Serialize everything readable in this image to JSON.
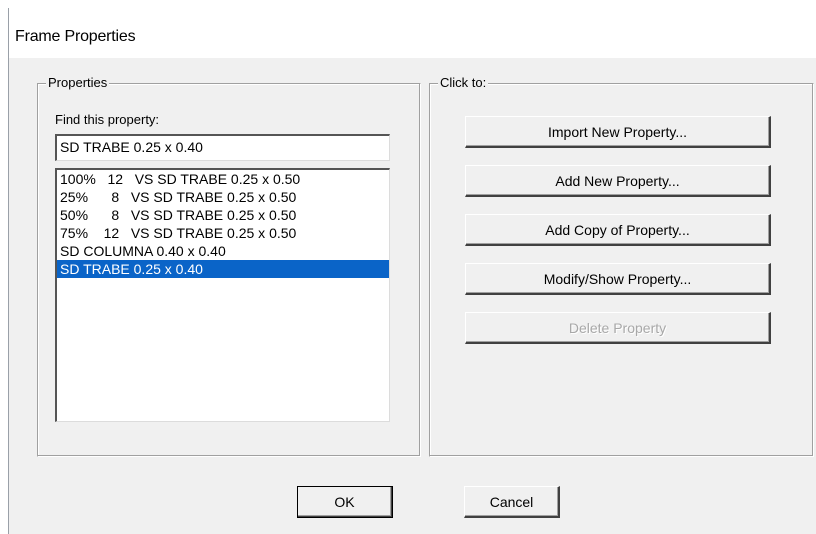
{
  "window": {
    "title": "Frame Properties"
  },
  "properties_group": {
    "label": "Properties",
    "find_label": "Find this property:",
    "find_value": "SD TRABE 0.25 x 0.40",
    "items": [
      "100%   12   VS SD TRABE 0.25 x 0.50",
      "25%      8   VS SD TRABE 0.25 x 0.50",
      "50%      8   VS SD TRABE 0.25 x 0.50",
      "75%    12   VS SD TRABE 0.25 x 0.50",
      "SD COLUMNA 0.40 x 0.40",
      "SD TRABE 0.25 x 0.40"
    ],
    "selected_item": "SD TRABE 0.25 x 0.40"
  },
  "click_group": {
    "label": "Click to:",
    "import_label": "Import New Property...",
    "add_label": "Add New Property...",
    "copy_label": "Add Copy of Property...",
    "modify_label": "Modify/Show Property...",
    "delete_label": "Delete Property"
  },
  "footer": {
    "ok_label": "OK",
    "cancel_label": "Cancel"
  }
}
